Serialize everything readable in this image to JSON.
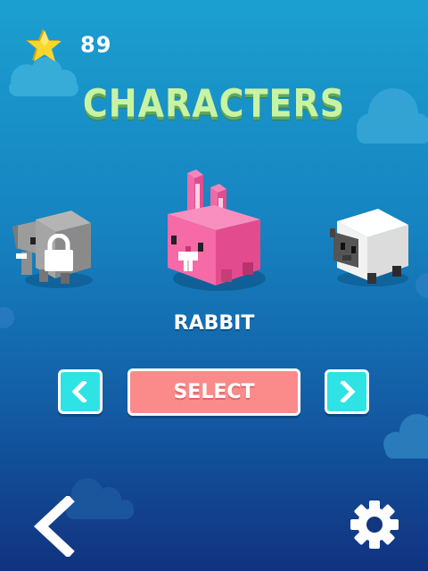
{
  "hud": {
    "coin_count": "89",
    "star_icon": "star-icon"
  },
  "title": "CHARACTERS",
  "carousel": {
    "selected_name": "RABBIT",
    "characters": [
      {
        "id": "elephant",
        "locked": true
      },
      {
        "id": "rabbit",
        "locked": false,
        "selected": true
      },
      {
        "id": "sheep",
        "locked": false
      }
    ]
  },
  "buttons": {
    "select_label": "SELECT",
    "prev_icon": "chevron-left-icon",
    "next_icon": "chevron-right-icon",
    "back_icon": "back-arrow-icon",
    "settings_icon": "gear-icon"
  },
  "colors": {
    "title": "#c8f3a3",
    "arrow_button": "#2ee3e3",
    "select_button": "#fb8a8a",
    "rabbit": "#f05ea1",
    "sheep": "#ffffff",
    "elephant": "#9b9b9b"
  }
}
